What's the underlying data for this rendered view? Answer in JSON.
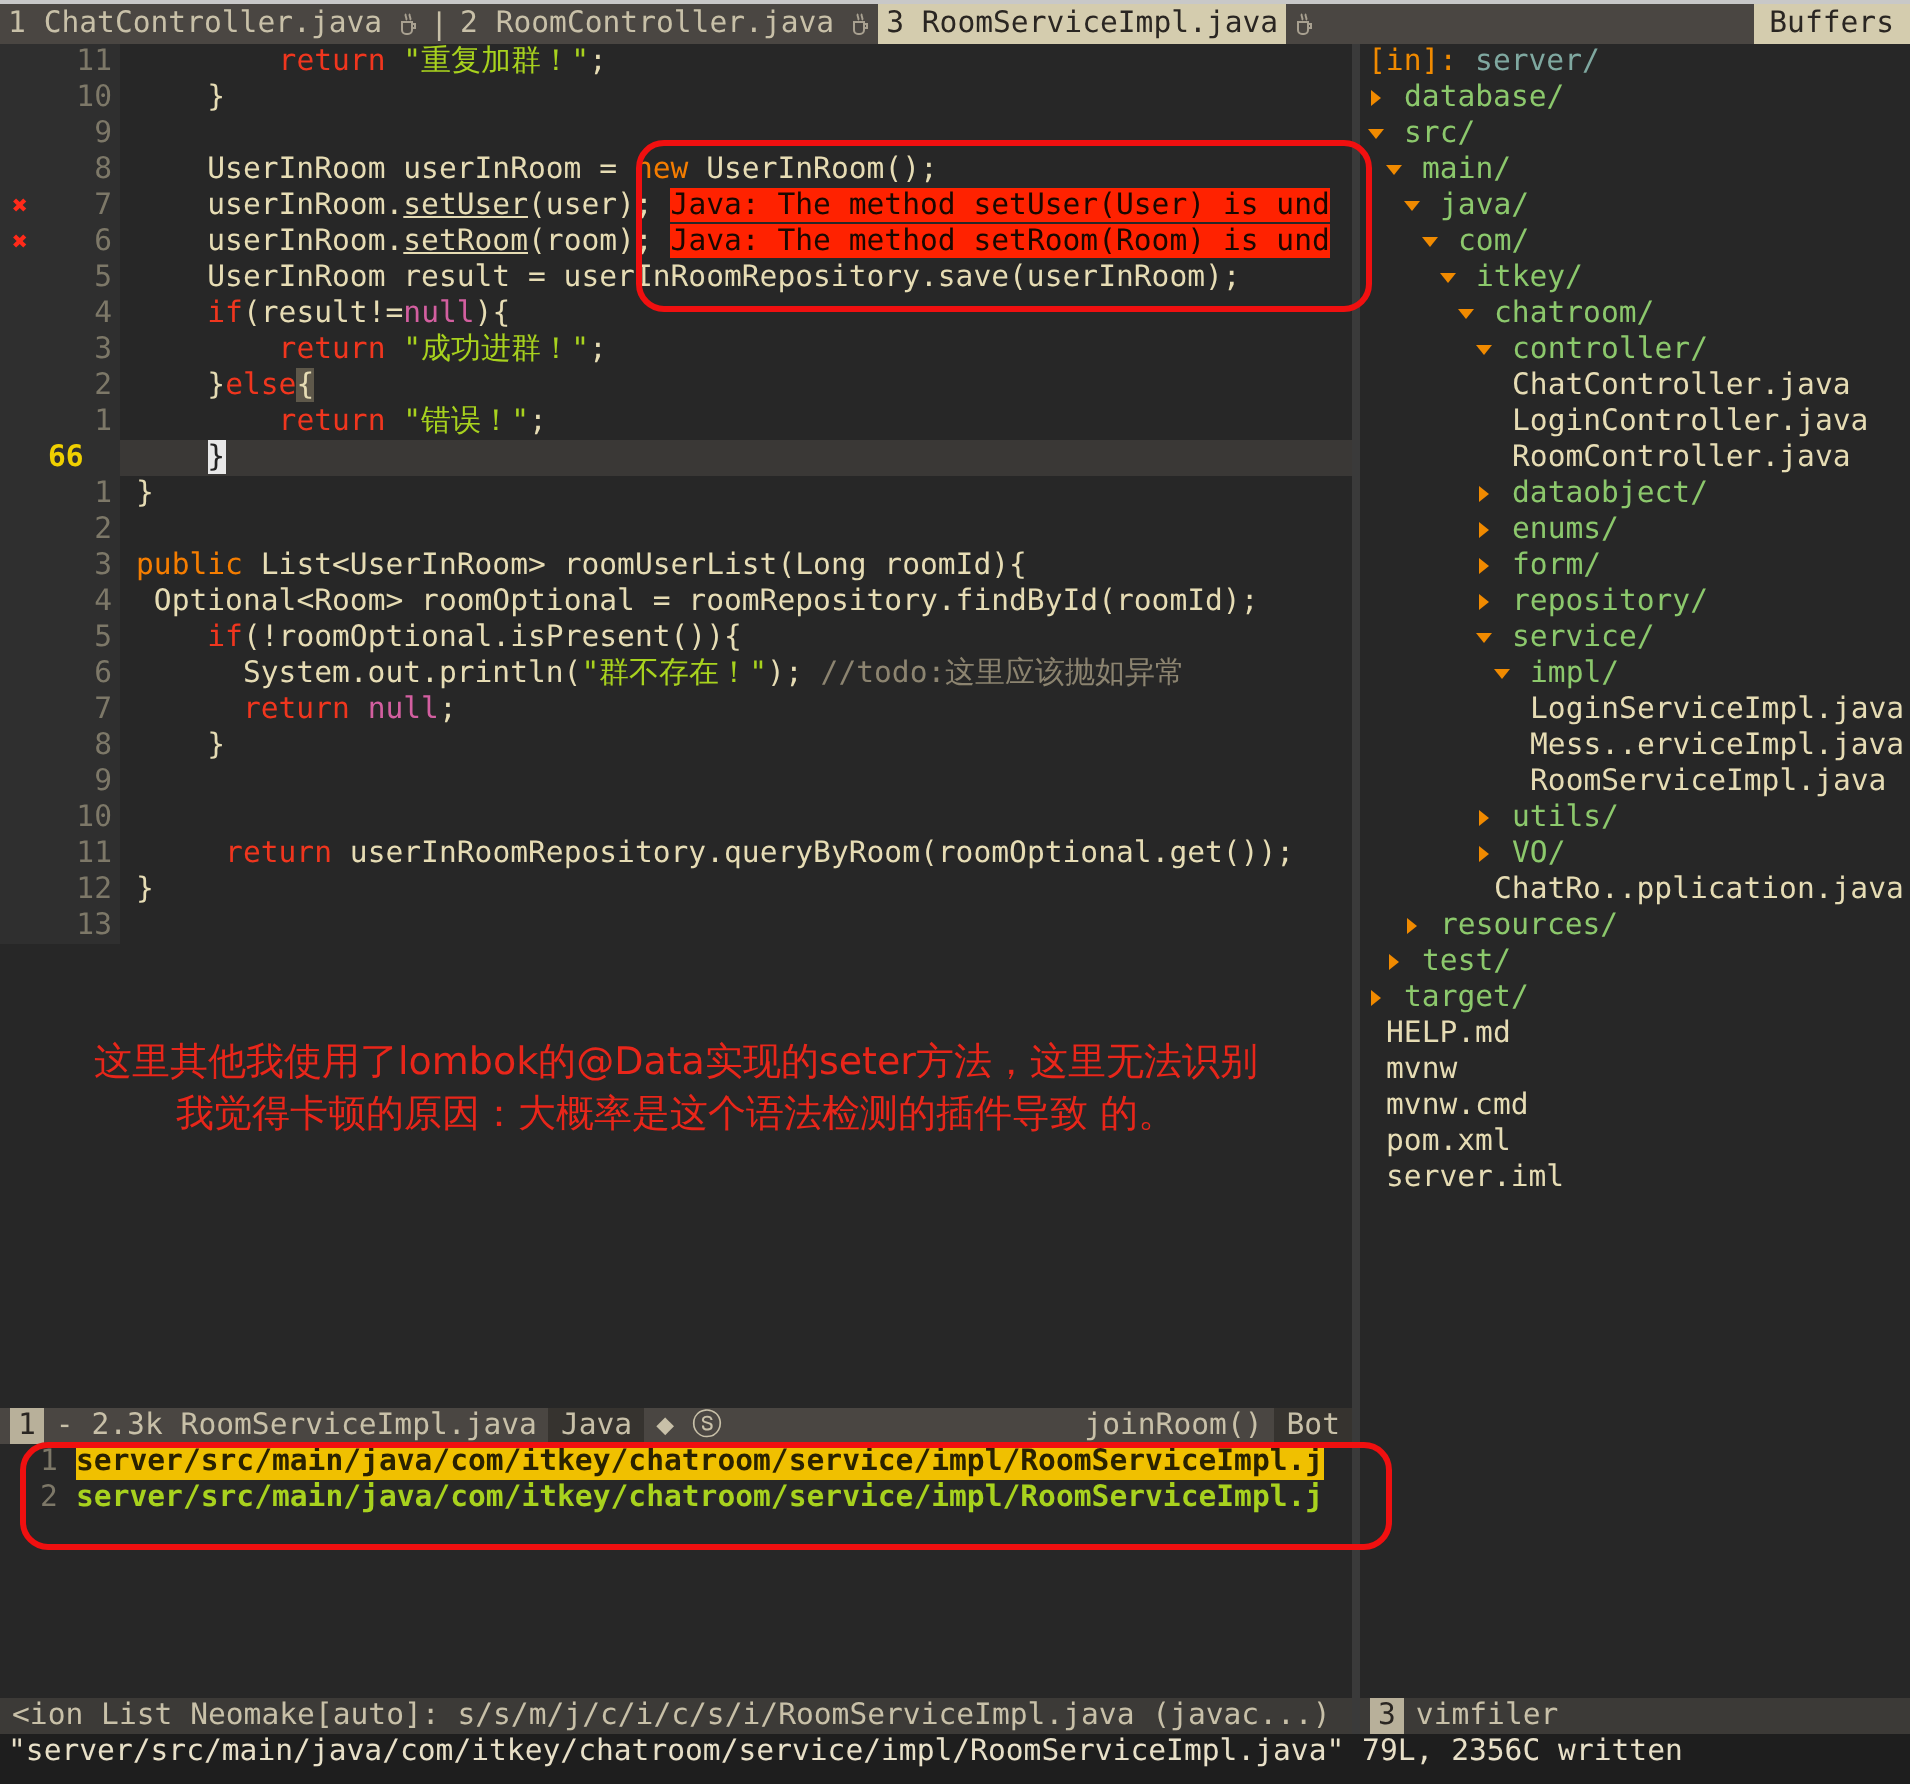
{
  "tabline": {
    "tabs": [
      {
        "label": "1 ChatController.java",
        "selected": false
      },
      {
        "label": "2 RoomController.java",
        "selected": false
      },
      {
        "label": "3 RoomServiceImpl.java",
        "selected": true
      }
    ],
    "separator": "|",
    "right_label": "Buffers"
  },
  "editor": {
    "lines": [
      {
        "num": "11",
        "current": false,
        "tokens": [
          {
            "text": "        return",
            "kind": "keyword"
          },
          {
            "text": " \"重复加群！\"",
            "kind": "string"
          },
          {
            "text": ";",
            "kind": "plain"
          }
        ]
      },
      {
        "num": "10",
        "current": false,
        "tokens": [
          {
            "text": "    }",
            "kind": "plain"
          }
        ]
      },
      {
        "num": "9",
        "current": false
      },
      {
        "num": "8",
        "current": false,
        "tokens": [
          {
            "text": "    UserInRoom userInRoom = ",
            "kind": "plain"
          },
          {
            "text": "new",
            "kind": "storage"
          },
          {
            "text": " UserInRoom();",
            "kind": "plain"
          }
        ]
      },
      {
        "num": "7",
        "current": false,
        "sign": "✖",
        "tokens": [
          {
            "text": "    userInRoom.",
            "kind": "plain"
          },
          {
            "text": "setUser",
            "kind": "underline"
          },
          {
            "text": "(user); ",
            "kind": "plain"
          },
          {
            "text": "Java: The method setUser(User) is und",
            "kind": "error"
          }
        ]
      },
      {
        "num": "6",
        "current": false,
        "sign": "✖",
        "tokens": [
          {
            "text": "    userInRoom.",
            "kind": "plain"
          },
          {
            "text": "setRoom",
            "kind": "underline"
          },
          {
            "text": "(room); ",
            "kind": "plain"
          },
          {
            "text": "Java: The method setRoom(Room) is und",
            "kind": "error"
          }
        ]
      },
      {
        "num": "5",
        "current": false,
        "tokens": [
          {
            "text": "    UserInRoom result = userInRoomRepository.save(userInRoom);",
            "kind": "plain"
          }
        ]
      },
      {
        "num": "4",
        "current": false,
        "tokens": [
          {
            "text": "    if",
            "kind": "keyword"
          },
          {
            "text": "(result!=",
            "kind": "plain"
          },
          {
            "text": "null",
            "kind": "literal"
          },
          {
            "text": "){",
            "kind": "plain"
          }
        ]
      },
      {
        "num": "3",
        "current": false,
        "tokens": [
          {
            "text": "        return",
            "kind": "keyword"
          },
          {
            "text": " \"成功进群！\"",
            "kind": "string"
          },
          {
            "text": ";",
            "kind": "plain"
          }
        ]
      },
      {
        "num": "2",
        "current": false,
        "tokens": [
          {
            "text": "    }",
            "kind": "plain"
          },
          {
            "text": "else",
            "kind": "keyword"
          },
          {
            "text": "{",
            "kind": "match"
          }
        ]
      },
      {
        "num": "1",
        "current": false,
        "tokens": [
          {
            "text": "        return",
            "kind": "keyword"
          },
          {
            "text": " \"错误！\"",
            "kind": "string"
          },
          {
            "text": ";",
            "kind": "plain"
          }
        ]
      },
      {
        "num": "66",
        "current": true,
        "tokens": [
          {
            "text": "    }",
            "kind": "cursor"
          }
        ]
      },
      {
        "num": "1",
        "current": false,
        "tokens": [
          {
            "text": "}",
            "kind": "plain"
          }
        ]
      },
      {
        "num": "2",
        "current": false
      },
      {
        "num": "3",
        "current": false,
        "tokens": [
          {
            "text": "public",
            "kind": "storage"
          },
          {
            "text": " List<UserInRoom> roomUserList(Long roomId){",
            "kind": "plain"
          }
        ]
      },
      {
        "num": "4",
        "current": false,
        "tokens": [
          {
            "text": " Optional<Room> roomOptional = roomRepository.findById(roomId);",
            "kind": "plain"
          }
        ]
      },
      {
        "num": "5",
        "current": false,
        "tokens": [
          {
            "text": "    if",
            "kind": "keyword"
          },
          {
            "text": "(!roomOptional.isPresent()){",
            "kind": "plain"
          }
        ]
      },
      {
        "num": "6",
        "current": false,
        "tokens": [
          {
            "text": "      System.out.println(",
            "kind": "plain"
          },
          {
            "text": "\"群不存在！\"",
            "kind": "string"
          },
          {
            "text": "); ",
            "kind": "plain"
          },
          {
            "text": "//todo:这里应该抛如异常",
            "kind": "comment"
          }
        ]
      },
      {
        "num": "7",
        "current": false,
        "tokens": [
          {
            "text": "      return",
            "kind": "keyword"
          },
          {
            "text": " null",
            "kind": "literal"
          },
          {
            "text": ";",
            "kind": "plain"
          }
        ]
      },
      {
        "num": "8",
        "current": false,
        "tokens": [
          {
            "text": "    }",
            "kind": "plain"
          }
        ]
      },
      {
        "num": "9",
        "current": false
      },
      {
        "num": "10",
        "current": false
      },
      {
        "num": "11",
        "current": false,
        "tokens": [
          {
            "text": "     return",
            "kind": "keyword"
          },
          {
            "text": " userInRoomRepository.queryByRoom(roomOptional.get());",
            "kind": "plain"
          }
        ]
      },
      {
        "num": "12",
        "current": false,
        "tokens": [
          {
            "text": "}",
            "kind": "plain"
          }
        ]
      },
      {
        "num": "13",
        "current": false
      }
    ],
    "annotations": [
      "这里其他我使用了lombok的@Data实现的seter方法，这里无法识别",
      "我觉得卡顿的原因：大概率是这个语法检测的插件导致 的。"
    ]
  },
  "editor_status": {
    "left": [
      {
        "text": "1",
        "kind": "mode"
      },
      {
        "text": "- 2.3k RoomServiceImpl.java",
        "kind": "info"
      },
      {
        "text": "Java",
        "kind": "dark"
      },
      {
        "text": "◆ ⓢ",
        "kind": "info"
      }
    ],
    "right": [
      {
        "text": "joinRoom()",
        "kind": "info"
      },
      {
        "text": "Bot",
        "kind": "dark"
      }
    ]
  },
  "quickfix": {
    "rows": [
      {
        "num": "1",
        "path": "server/src/main/java/com/itkey/chatroom/service/impl/RoomServiceImpl.j",
        "selected": true
      },
      {
        "num": "2",
        "path": "server/src/main/java/com/itkey/chatroom/service/impl/RoomServiceImpl.j",
        "selected": false
      }
    ]
  },
  "quickfix_status": {
    "left": [
      {
        "text": "<ion List Neomake[auto]: s/s/m/j/c/i/c/s/i/RoomServiceImpl.java (javac...)",
        "kind": "info"
      }
    ]
  },
  "filer": {
    "prefix": "[in]:",
    "path": "server/",
    "tree": [
      {
        "name": "database/",
        "kind": "dir",
        "expanded": false
      },
      {
        "name": "src/",
        "kind": "dir",
        "expanded": true,
        "children": [
          {
            "name": "main/",
            "kind": "dir",
            "expanded": true,
            "children": [
              {
                "name": "java/",
                "kind": "dir",
                "expanded": true,
                "children": [
                  {
                    "name": "com/",
                    "kind": "dir",
                    "expanded": true,
                    "children": [
                      {
                        "name": "itkey/",
                        "kind": "dir",
                        "expanded": true,
                        "children": [
                          {
                            "name": "chatroom/",
                            "kind": "dir",
                            "expanded": true,
                            "children": [
                              {
                                "name": "controller/",
                                "kind": "dir",
                                "expanded": true,
                                "children": [
                                  {
                                    "name": "ChatController.java",
                                    "kind": "file"
                                  },
                                  {
                                    "name": "LoginController.java",
                                    "kind": "file"
                                  },
                                  {
                                    "name": "RoomController.java",
                                    "kind": "file"
                                  }
                                ]
                              },
                              {
                                "name": "dataobject/",
                                "kind": "dir",
                                "expanded": false
                              },
                              {
                                "name": "enums/",
                                "kind": "dir",
                                "expanded": false
                              },
                              {
                                "name": "form/",
                                "kind": "dir",
                                "expanded": false
                              },
                              {
                                "name": "repository/",
                                "kind": "dir",
                                "expanded": false
                              },
                              {
                                "name": "service/",
                                "kind": "dir",
                                "expanded": true,
                                "children": [
                                  {
                                    "name": "impl/",
                                    "kind": "dir",
                                    "expanded": true,
                                    "children": [
                                      {
                                        "name": "LoginServiceImpl.java",
                                        "kind": "file"
                                      },
                                      {
                                        "name": "Mess..erviceImpl.java",
                                        "kind": "file"
                                      },
                                      {
                                        "name": "RoomServiceImpl.java",
                                        "kind": "file"
                                      }
                                    ]
                                  }
                                ]
                              },
                              {
                                "name": "utils/",
                                "kind": "dir",
                                "expanded": false
                              },
                              {
                                "name": "VO/",
                                "kind": "dir",
                                "expanded": false
                              },
                              {
                                "name": "ChatRo..pplication.java",
                                "kind": "file"
                              }
                            ]
                          }
                        ]
                      }
                    ]
                  }
                ]
              },
              {
                "name": "resources/",
                "kind": "dir",
                "expanded": false
              }
            ]
          },
          {
            "name": "test/",
            "kind": "dir",
            "expanded": false
          }
        ]
      },
      {
        "name": "target/",
        "kind": "dir",
        "expanded": false
      },
      {
        "name": "HELP.md",
        "kind": "file"
      },
      {
        "name": "mvnw",
        "kind": "file"
      },
      {
        "name": "mvnw.cmd",
        "kind": "file"
      },
      {
        "name": "pom.xml",
        "kind": "file"
      },
      {
        "name": "server.iml",
        "kind": "file"
      }
    ]
  },
  "filer_status": {
    "left": [
      {
        "text": "3",
        "kind": "mode"
      },
      {
        "text": "vimfiler",
        "kind": "info"
      }
    ]
  },
  "cmdline": "\"server/src/main/java/com/itkey/chatroom/service/impl/RoomServiceImpl.java\" 79L, 2356C written"
}
